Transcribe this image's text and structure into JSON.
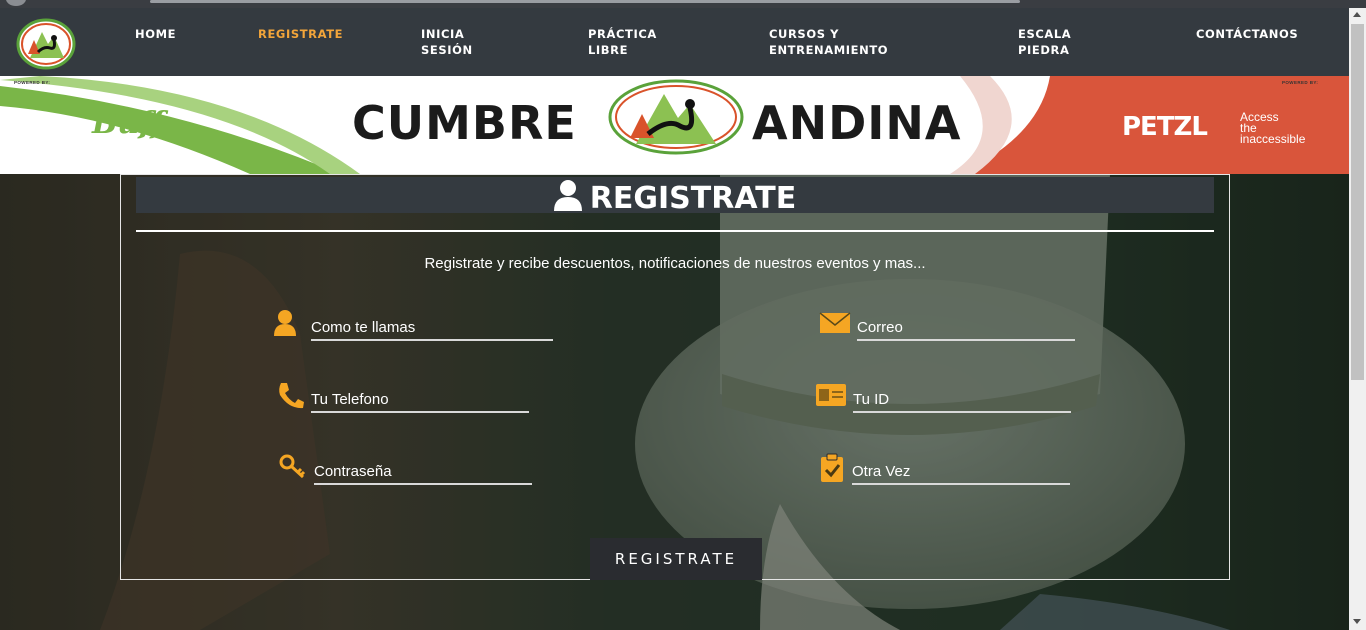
{
  "nav": {
    "items": [
      {
        "label": "HOME",
        "active": false
      },
      {
        "label": "REGISTRATE",
        "active": true
      },
      {
        "label": "INICIA\nSESIÓN",
        "active": false
      },
      {
        "label": "PRÁCTICA\nLIBRE",
        "active": false
      },
      {
        "label": "CURSOS Y\nENTRENAMIENTO",
        "active": false
      },
      {
        "label": "ESCALA\nPIEDRA",
        "active": false
      },
      {
        "label": "CONTÁCTANOS",
        "active": false
      }
    ],
    "active_color": "#f3a53a"
  },
  "banner": {
    "powered_left": "POWERED BY:",
    "powered_right": "POWERED BY:",
    "title_left": "CUMBRE",
    "title_right": "ANDINA",
    "sponsor_left": "Buff",
    "sponsor_right": "PETZL",
    "sponsor_right_tagline": "Access\nthe\ninaccessible"
  },
  "form": {
    "title": "REGISTRATE",
    "subtitle": "Registrate y recibe descuentos, notificaciones de nuestros eventos y mas...",
    "fields": {
      "name": {
        "placeholder": "Como te llamas",
        "icon": "user-icon"
      },
      "email": {
        "placeholder": "Correo",
        "icon": "envelope-icon"
      },
      "phone": {
        "placeholder": "Tu Telefono",
        "icon": "phone-icon"
      },
      "id": {
        "placeholder": "Tu ID",
        "icon": "id-card-icon"
      },
      "password": {
        "placeholder": "Contraseña",
        "icon": "key-icon"
      },
      "password_confirm": {
        "placeholder": "Otra Vez",
        "icon": "clipboard-check-icon"
      }
    },
    "submit_label": "REGISTRATE",
    "icon_color": "#f5a623"
  }
}
